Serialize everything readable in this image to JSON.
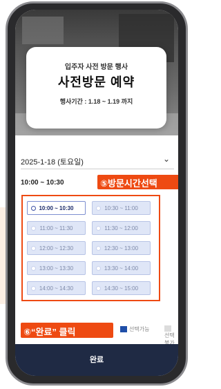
{
  "event": {
    "subtitle": "입주자 사전 방문 행사",
    "title": "사전방문 예약",
    "period": "행사기간 : 1.18 ~ 1.19 까지"
  },
  "date_select": {
    "value": "2025-1-18 (토요일)",
    "icon": "chevron-down-icon"
  },
  "time_select": {
    "value": "10:00 ~ 10:30",
    "icon": "chevron-right-icon"
  },
  "callouts": {
    "step5": "⑤방문시간선택",
    "step6": "⑥“완료” 클릭",
    "color": "#ee4a12"
  },
  "time_slots": [
    {
      "label": "10:00 ~ 10:30",
      "selected": true
    },
    {
      "label": "10:30 ~ 11:00",
      "selected": false
    },
    {
      "label": "11:00 ~ 11:30",
      "selected": false
    },
    {
      "label": "11:30 ~ 12:00",
      "selected": false
    },
    {
      "label": "12:00 ~ 12:30",
      "selected": false
    },
    {
      "label": "12:30 ~ 13:00",
      "selected": false
    },
    {
      "label": "13:00 ~ 13:30",
      "selected": false
    },
    {
      "label": "13:30 ~ 14:00",
      "selected": false
    },
    {
      "label": "14:00 ~ 14:30",
      "selected": false
    },
    {
      "label": "14:30 ~ 15:00",
      "selected": false
    }
  ],
  "legend": {
    "available": "선택가능",
    "unavailable": "선택불가",
    "available_color": "#1f4ea8",
    "unavailable_color": "#dcdcdc"
  },
  "complete_button": {
    "label": "완료",
    "color": "#1f2a44"
  }
}
